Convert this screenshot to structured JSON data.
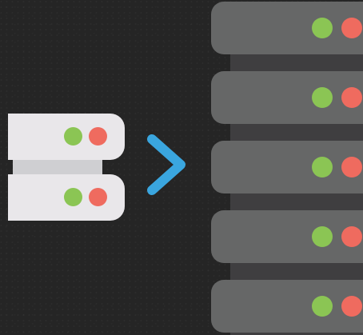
{
  "scene": {
    "description_icons": [
      "server-icon",
      "arrow-right-icon",
      "server-rack-icon"
    ]
  },
  "colors": {
    "background": "#252525",
    "small_server": "#e9e7ea",
    "small_connector": "#cfcfd2",
    "rack_unit": "#666767",
    "rack_spine": "#3f3e40",
    "arrow": "#3aa6df",
    "led_green": "#8bc554",
    "led_red": "#ef6b5f"
  },
  "small_server": {
    "units": 2
  },
  "rack": {
    "units": 5
  }
}
